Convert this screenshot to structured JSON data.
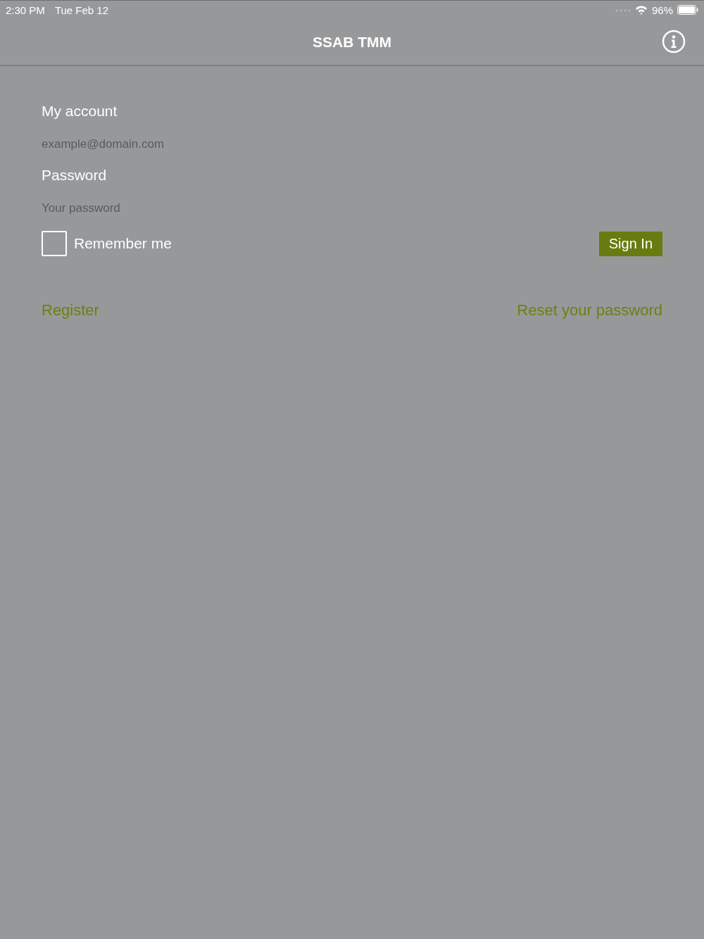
{
  "status_bar": {
    "time": "2:30 PM",
    "date": "Tue Feb 12",
    "battery": "96%"
  },
  "nav_bar": {
    "title": "SSAB TMM"
  },
  "form": {
    "account_label": "My account",
    "email": {
      "placeholder": "example@domain.com"
    },
    "password_label": "Password",
    "password": {
      "placeholder": "Your password"
    },
    "remember": {
      "label": "Remember me",
      "checked": false
    },
    "sign_in": "Sign In"
  },
  "links": [
    "Register",
    "Reset your password"
  ]
}
